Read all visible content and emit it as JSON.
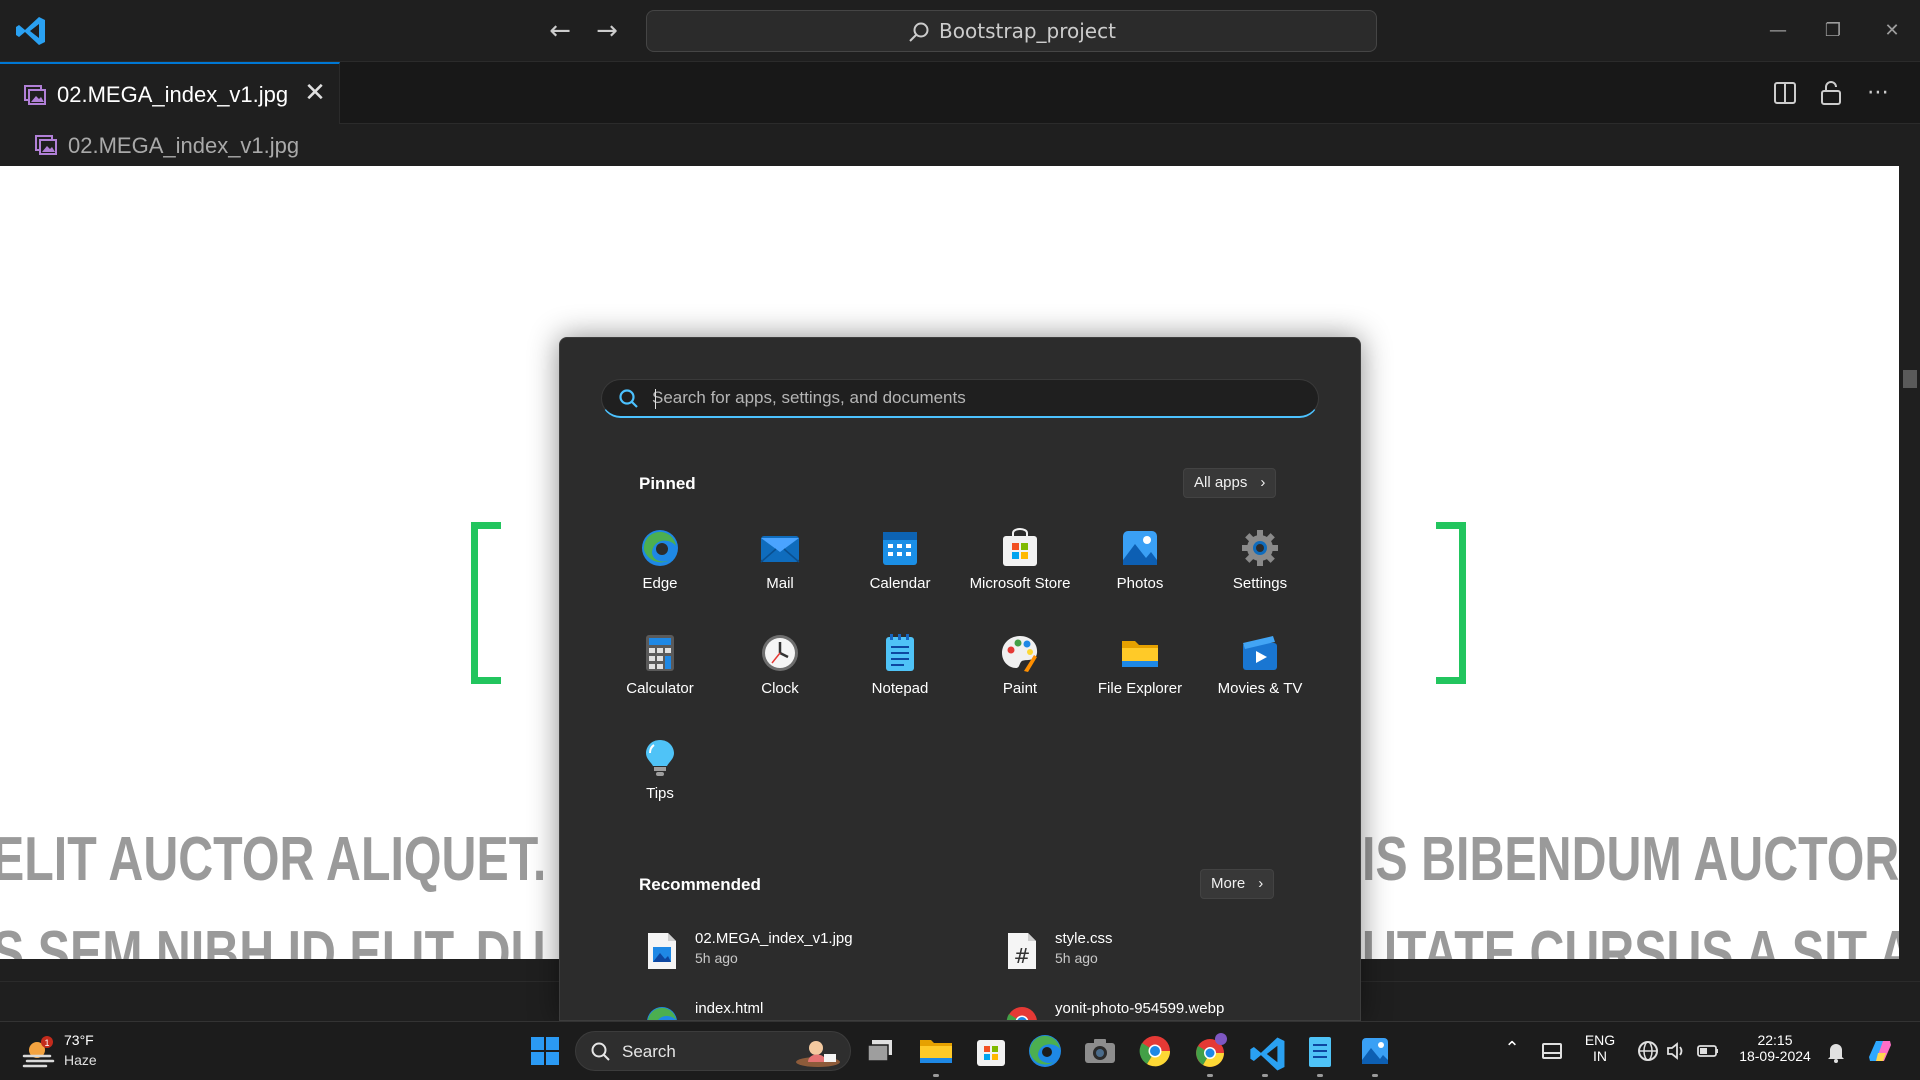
{
  "titlebar": {
    "search_text": "Bootstrap_project",
    "accent": "#0078d4"
  },
  "tab": {
    "label": "02.MEGA_index_v1.jpg",
    "close_glyph": "✕"
  },
  "breadcrumb": {
    "label": "02.MEGA_index_v1.jpg"
  },
  "image_content": {
    "line1_left": "ELIT AUCTOR ALIQUET. A",
    "line1_right": "IS BIBENDUM AUCTOR,",
    "line2_left": "S SEM NIBH ID ELIT. DU",
    "line2_right": "UTATE CURSUS A SIT A",
    "bracket_color": "#22c55e"
  },
  "start_menu": {
    "search_placeholder": "Search for apps, settings, and documents",
    "pinned_title": "Pinned",
    "all_apps_label": "All apps",
    "pinned": [
      {
        "label": "Edge",
        "icon": "edge-icon"
      },
      {
        "label": "Mail",
        "icon": "mail-icon"
      },
      {
        "label": "Calendar",
        "icon": "calendar-icon"
      },
      {
        "label": "Microsoft Store",
        "icon": "store-icon"
      },
      {
        "label": "Photos",
        "icon": "photos-icon"
      },
      {
        "label": "Settings",
        "icon": "settings-icon"
      },
      {
        "label": "Calculator",
        "icon": "calculator-icon"
      },
      {
        "label": "Clock",
        "icon": "clock-icon"
      },
      {
        "label": "Notepad",
        "icon": "notepad-icon"
      },
      {
        "label": "Paint",
        "icon": "paint-icon"
      },
      {
        "label": "File Explorer",
        "icon": "folder-icon"
      },
      {
        "label": "Movies & TV",
        "icon": "movies-icon"
      },
      {
        "label": "Tips",
        "icon": "tips-icon"
      }
    ],
    "recommended_title": "Recommended",
    "more_label": "More",
    "recommended": [
      {
        "name": "02.MEGA_index_v1.jpg",
        "time": "5h ago",
        "icon": "image-file-icon"
      },
      {
        "name": "style.css",
        "time": "5h ago",
        "icon": "css-file-icon"
      },
      {
        "name": "index.html",
        "time": "",
        "icon": "edge-file-icon"
      },
      {
        "name": "yonit-photo-954599.webp",
        "time": "",
        "icon": "chrome-file-icon"
      }
    ]
  },
  "taskbar": {
    "weather_temp": "73°F",
    "weather_desc": "Haze",
    "weather_badge": "1",
    "search_label": "Search",
    "language_top": "ENG",
    "language_bottom": "IN",
    "time": "22:15",
    "date": "18-09-2024"
  }
}
